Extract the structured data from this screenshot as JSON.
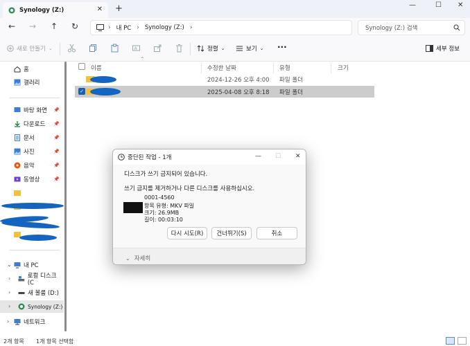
{
  "window": {
    "tab_title": "Synology (Z:)",
    "new_tab": "+",
    "close_tab": "✕",
    "minimize": "—",
    "maximize": "☐",
    "close": "✕"
  },
  "nav": {
    "back": "←",
    "forward": "→",
    "up": "↑",
    "refresh": "↻",
    "breadcrumb": [
      "내 PC",
      "Synology (Z:)"
    ],
    "search_placeholder": "Synology (Z:) 검색"
  },
  "toolbar": {
    "new_label": "새로 만들기",
    "sort_label": "정렬",
    "view_label": "보기",
    "more_label": "···",
    "details_label": "세부 정보"
  },
  "sidebar": {
    "items": [
      {
        "label": "홈",
        "icon": "home-icon"
      },
      {
        "label": "갤러리",
        "icon": "gallery-icon"
      },
      {
        "label": "바탕 화면",
        "icon": "desktop-icon"
      },
      {
        "label": "다운로드",
        "icon": "download-icon"
      },
      {
        "label": "문서",
        "icon": "documents-icon"
      },
      {
        "label": "사진",
        "icon": "pictures-icon"
      },
      {
        "label": "음악",
        "icon": "music-icon"
      },
      {
        "label": "동영상",
        "icon": "videos-icon"
      },
      {
        "label": "내 PC",
        "icon": "pc-icon"
      },
      {
        "label": "로컬 디스크 (C",
        "icon": "drive-icon"
      },
      {
        "label": "새 볼륨 (D:)",
        "icon": "drive-icon"
      },
      {
        "label": "Synology (Z:)",
        "icon": "network-drive-icon"
      },
      {
        "label": "네트워크",
        "icon": "network-icon"
      }
    ]
  },
  "columns": {
    "name": "이름",
    "modified": "수정한 날짜",
    "type": "유형",
    "size": "크기"
  },
  "files": [
    {
      "modified": "2024-12-26 오후 4:00",
      "type": "파일 폴더"
    },
    {
      "modified": "2025-04-08 오후 8:18",
      "type": "파일 폴더"
    }
  ],
  "status": {
    "count": "2개 항목",
    "selected": "1개 항목 선택함"
  },
  "dialog": {
    "title": "중단된 작업 - 1개",
    "message1": "디스크가 쓰기 금지되어 있습니다.",
    "message2": "쓰기 금지를 제거하거나 다른 디스크를 사용하십시오.",
    "file_name": "0001-4560",
    "file_type": "항목 유형: MKV 파일",
    "file_size": "크기: 26.9MB",
    "file_length": "길이: 00:03:10",
    "retry": "다시 시도(R)",
    "skip": "건너뛰기(S)",
    "cancel": "취소",
    "details": "자세히"
  },
  "colors": {
    "accent": "#1a5fb4",
    "folder": "#f3c23d",
    "redaction": "#1565c0"
  }
}
